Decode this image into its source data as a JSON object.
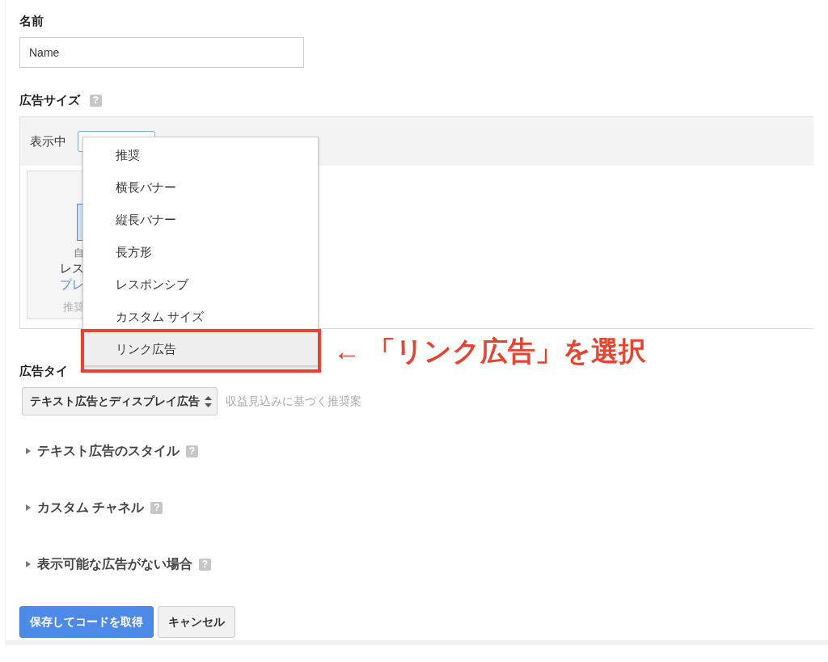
{
  "name_field": {
    "label": "名前",
    "value": "Name"
  },
  "ad_size": {
    "label": "広告サイズ",
    "help": "?",
    "filter_label": "表示中",
    "card": {
      "lines": [
        {
          "text": "自",
          "kind": "muted"
        },
        {
          "text": "レス",
          "kind": "plain"
        },
        {
          "text": "プレ",
          "kind": "link"
        },
        {
          "text": "推奨",
          "kind": "faint"
        }
      ]
    },
    "dropdown": {
      "items": [
        {
          "label": "推奨",
          "selected": false
        },
        {
          "label": "横長バナー",
          "selected": false
        },
        {
          "label": "縦長バナー",
          "selected": false
        },
        {
          "label": "長方形",
          "selected": false
        },
        {
          "label": "レスポンシブ",
          "selected": false
        },
        {
          "label": "カスタム サイズ",
          "selected": false
        },
        {
          "label": "リンク広告",
          "selected": true
        }
      ]
    }
  },
  "annotation": {
    "text": "← 「リンク広告」を選択"
  },
  "ad_type": {
    "label": "広告タイ",
    "select_value": "テキスト広告とディスプレイ広告",
    "hint": "収益見込みに基づく推奨案"
  },
  "sections": [
    {
      "label": "テキスト広告のスタイル",
      "help": "?",
      "expanded": false
    },
    {
      "label": "カスタム チャネル",
      "help": "?",
      "expanded": false
    },
    {
      "label": "表示可能な広告がない場合",
      "help": "?",
      "expanded": false
    }
  ],
  "buttons": [
    {
      "label": "保存してコードを取得",
      "kind": "primary"
    },
    {
      "label": "キャンセル",
      "kind": "secondary"
    }
  ]
}
